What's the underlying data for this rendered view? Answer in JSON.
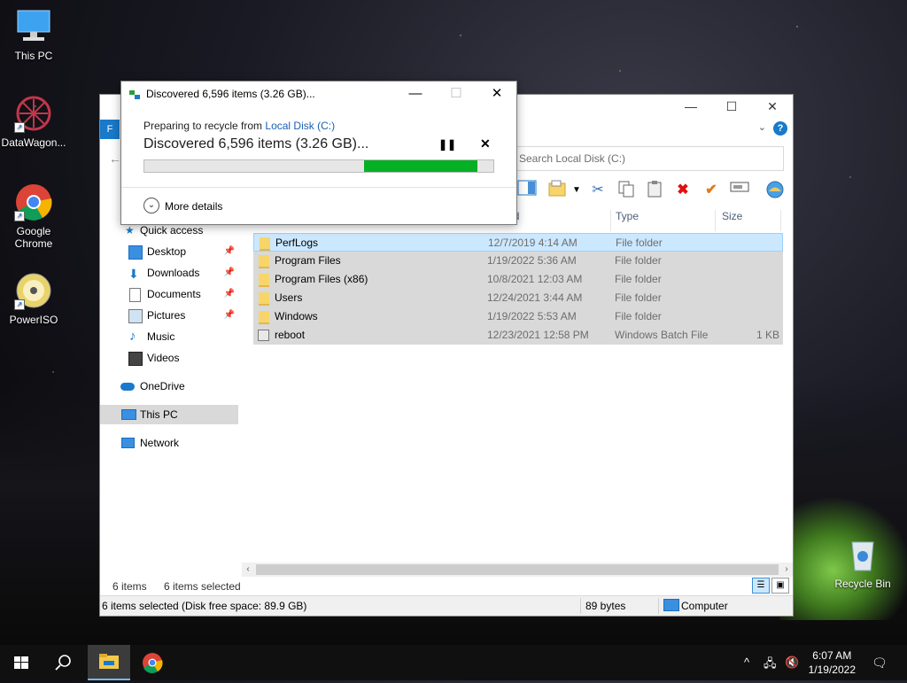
{
  "desktop": {
    "icons": [
      {
        "label": "This PC",
        "icon": "this-pc-icon"
      },
      {
        "label": "DataWagon...",
        "icon": "datawagon-icon"
      },
      {
        "label": "Google Chrome",
        "icon": "chrome-icon"
      },
      {
        "label": "PowerISO",
        "icon": "poweriso-icon"
      },
      {
        "label": "Recycle Bin",
        "icon": "recycle-bin-icon"
      }
    ]
  },
  "explorer": {
    "file_tab": "F",
    "search_placeholder": "Search Local Disk (C:)",
    "columns": [
      "Date modified",
      "Type",
      "Size"
    ],
    "columns_visible": [
      "odified",
      "Type",
      "Size"
    ],
    "nav": [
      {
        "label": "Quick access",
        "icon": "star-icon"
      },
      {
        "label": "Desktop",
        "icon": "desktop-icon",
        "pinned": true
      },
      {
        "label": "Downloads",
        "icon": "download-icon",
        "pinned": true
      },
      {
        "label": "Documents",
        "icon": "documents-icon",
        "pinned": true
      },
      {
        "label": "Pictures",
        "icon": "pictures-icon",
        "pinned": true
      },
      {
        "label": "Music",
        "icon": "music-icon"
      },
      {
        "label": "Videos",
        "icon": "videos-icon"
      },
      {
        "label": "OneDrive",
        "icon": "onedrive-icon"
      },
      {
        "label": "This PC",
        "icon": "this-pc-icon"
      },
      {
        "label": "Network",
        "icon": "network-icon"
      }
    ],
    "files": [
      {
        "name": "PerfLogs",
        "date": "12/7/2019 4:14 AM",
        "type": "File folder",
        "size": ""
      },
      {
        "name": "Program Files",
        "date": "1/19/2022 5:36 AM",
        "type": "File folder",
        "size": ""
      },
      {
        "name": "Program Files (x86)",
        "date": "10/8/2021 12:03 AM",
        "type": "File folder",
        "size": ""
      },
      {
        "name": "Users",
        "date": "12/24/2021 3:44 AM",
        "type": "File folder",
        "size": ""
      },
      {
        "name": "Windows",
        "date": "1/19/2022 5:53 AM",
        "type": "File folder",
        "size": ""
      },
      {
        "name": "reboot",
        "date": "12/23/2021 12:58 PM",
        "type": "Windows Batch File",
        "size": "1 KB"
      }
    ],
    "status_count": "6 items",
    "status_selected": "6 items selected",
    "bottom_left": "6 items selected (Disk free space: 89.9 GB)",
    "bottom_size": "89 bytes",
    "bottom_location": "Computer"
  },
  "dialog": {
    "title": "Discovered 6,596 items (3.26 GB)...",
    "preparing_prefix": "Preparing to recycle from ",
    "preparing_link": "Local Disk (C:)",
    "headline": "Discovered 6,596 items (3.26 GB)...",
    "progress_start": 0.63,
    "progress_end": 0.955,
    "more_details": "More details"
  },
  "taskbar": {
    "time": "6:07 AM",
    "date": "1/19/2022"
  },
  "colors": {
    "accent": "#1979ca",
    "progress_green": "#06b025",
    "selection": "#cce8ff"
  }
}
